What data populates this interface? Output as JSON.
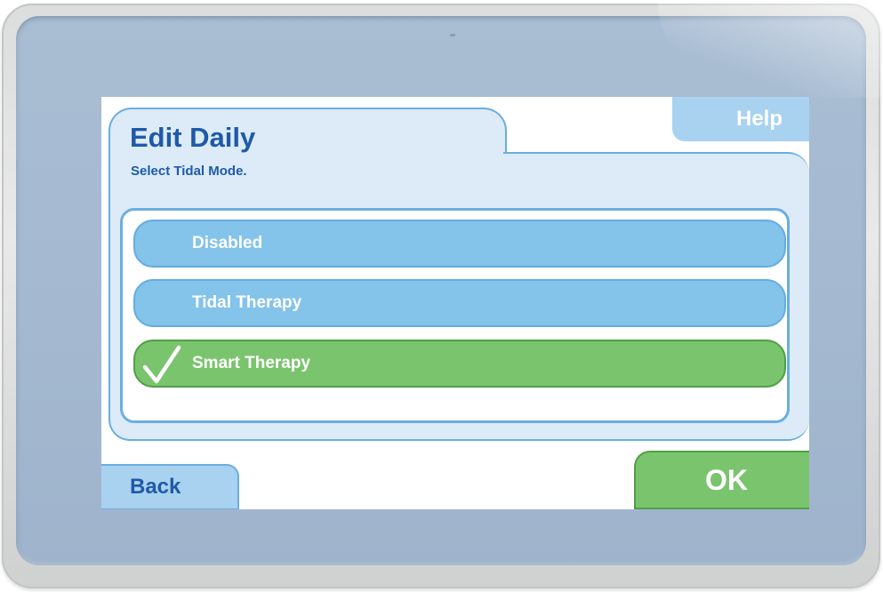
{
  "screen": {
    "title": "Edit Daily",
    "subtitle": "Select Tidal Mode.",
    "help_label": "Help",
    "back_label": "Back",
    "ok_label": "OK"
  },
  "options": [
    {
      "label": "Disabled",
      "selected": false
    },
    {
      "label": "Tidal Therapy",
      "selected": false
    },
    {
      "label": "Smart Therapy",
      "selected": true
    }
  ],
  "colors": {
    "title_blue": "#1f5aa6",
    "option_blue": "#84c3ea",
    "selected_green": "#7bc46e",
    "panel_bg": "#dcebf7",
    "bezel": "#a6bbd2"
  },
  "icons": {
    "selected_marker": "check-icon"
  }
}
